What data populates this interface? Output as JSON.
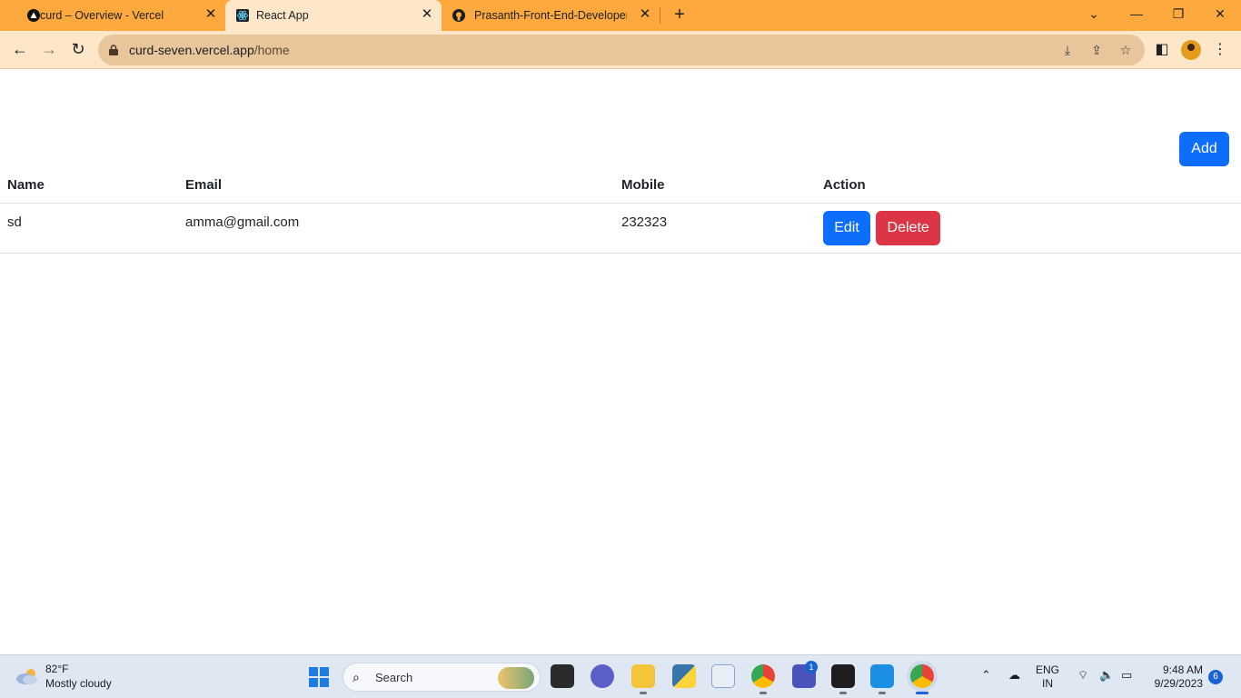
{
  "browser": {
    "tabs": [
      {
        "label": "curd – Overview - Vercel",
        "active": false
      },
      {
        "label": "React App",
        "active": true
      },
      {
        "label": "Prasanth-Front-End-Developer/C",
        "active": false
      }
    ],
    "new_tab": "+",
    "url_host": "curd-seven.vercel.app",
    "url_path": "/home"
  },
  "page": {
    "add_label": "Add",
    "table": {
      "headers": [
        "Name",
        "Email",
        "Mobile",
        "Action"
      ],
      "rows": [
        {
          "name": "sd",
          "email": "amma@gmail.com",
          "mobile": "232323",
          "edit_label": "Edit",
          "delete_label": "Delete"
        }
      ]
    }
  },
  "taskbar": {
    "weather_temp": "82°F",
    "weather_desc": "Mostly cloudy",
    "search_placeholder": "Search",
    "teams_badge": "1",
    "lang_line1": "ENG",
    "lang_line2": "IN",
    "time": "9:48 AM",
    "date": "9/29/2023",
    "notifications": "6"
  },
  "colors": {
    "tabstrip": "#fda93d",
    "toolbar": "#fde7c8",
    "primary": "#0d6efd",
    "danger": "#dc3545"
  }
}
